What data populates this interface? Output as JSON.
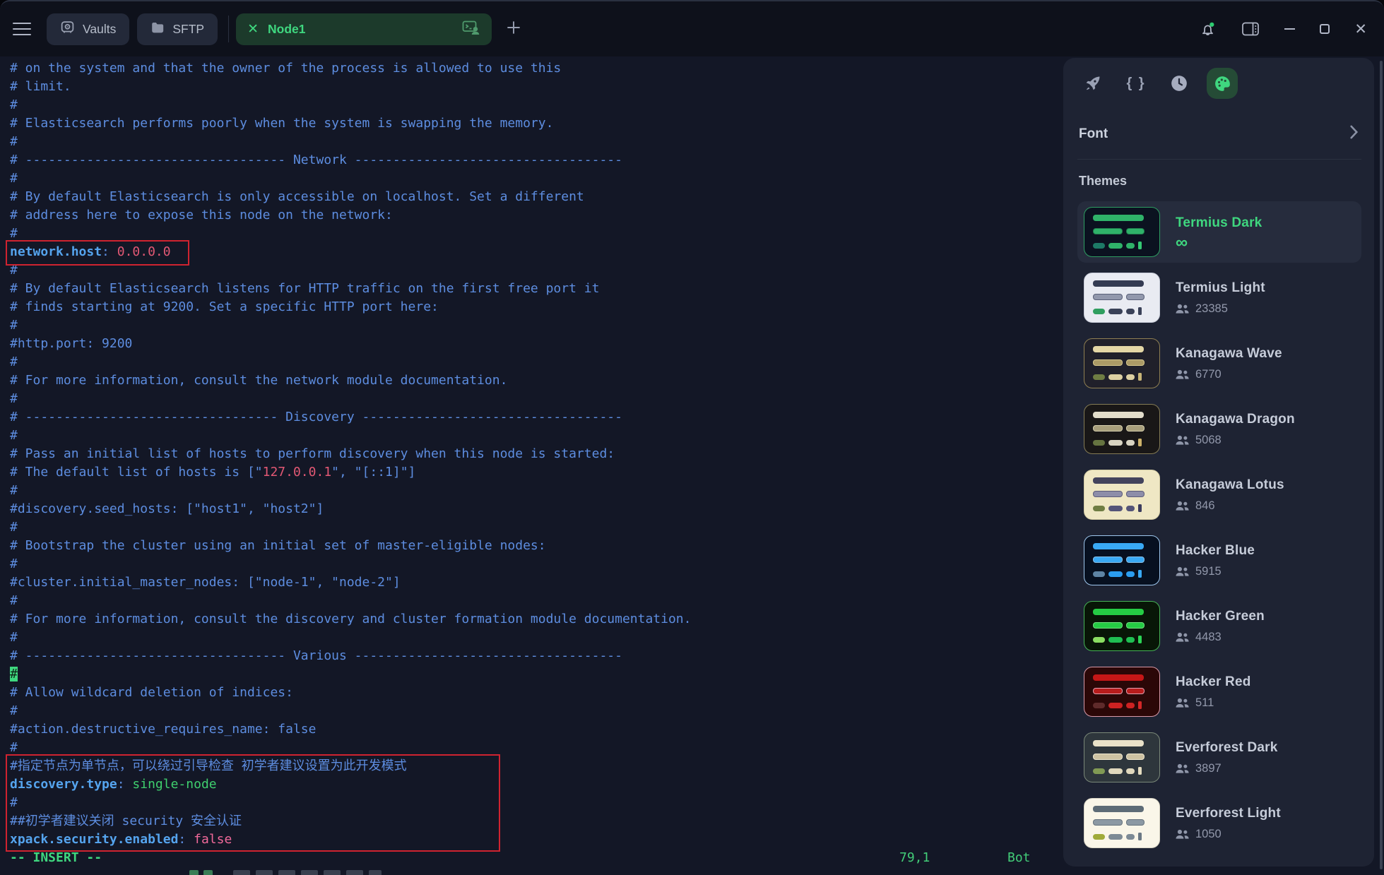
{
  "topbar": {
    "vaults_label": "Vaults",
    "sftp_label": "SFTP",
    "tab_label": "Node1"
  },
  "terminal": {
    "lines": [
      [
        [
          "c",
          "# on the system and that the owner of the process is allowed to use this"
        ]
      ],
      [
        [
          "c",
          "# limit."
        ]
      ],
      [
        [
          "c",
          "#"
        ]
      ],
      [
        [
          "c",
          "# Elasticsearch performs poorly when the system is swapping the memory."
        ]
      ],
      [
        [
          "c",
          "#"
        ]
      ],
      [
        [
          "c",
          "# ---------------------------------- Network -----------------------------------"
        ]
      ],
      [
        [
          "c",
          "#"
        ]
      ],
      [
        [
          "c",
          "# By default Elasticsearch is only accessible on localhost. Set a different"
        ]
      ],
      [
        [
          "c",
          "# address here to expose this node on the network:"
        ]
      ],
      [
        [
          "c",
          "#"
        ]
      ],
      [
        [
          "k",
          "network.host"
        ],
        [
          "c",
          ": "
        ],
        [
          "r",
          "0.0.0.0"
        ]
      ],
      [
        [
          "c",
          "#"
        ]
      ],
      [
        [
          "c",
          "# By default Elasticsearch listens for HTTP traffic on the first free port it"
        ]
      ],
      [
        [
          "c",
          "# finds starting at 9200. Set a specific HTTP port here:"
        ]
      ],
      [
        [
          "c",
          "#"
        ]
      ],
      [
        [
          "c",
          "#http.port: 9200"
        ]
      ],
      [
        [
          "c",
          "#"
        ]
      ],
      [
        [
          "c",
          "# For more information, consult the network module documentation."
        ]
      ],
      [
        [
          "c",
          "#"
        ]
      ],
      [
        [
          "c",
          "# --------------------------------- Discovery ----------------------------------"
        ]
      ],
      [
        [
          "c",
          "#"
        ]
      ],
      [
        [
          "c",
          "# Pass an initial list of hosts to perform discovery when this node is started:"
        ]
      ],
      [
        [
          "c",
          "# The default list of hosts is [\""
        ],
        [
          "r",
          "127.0.0.1"
        ],
        [
          "c",
          "\", \"[::1]\"]"
        ]
      ],
      [
        [
          "c",
          "#"
        ]
      ],
      [
        [
          "c",
          "#discovery.seed_hosts: [\"host1\", \"host2\"]"
        ]
      ],
      [
        [
          "c",
          "#"
        ]
      ],
      [
        [
          "c",
          "# Bootstrap the cluster using an initial set of master-eligible nodes:"
        ]
      ],
      [
        [
          "c",
          "#"
        ]
      ],
      [
        [
          "c",
          "#cluster.initial_master_nodes: [\"node-1\", \"node-2\"]"
        ]
      ],
      [
        [
          "c",
          "#"
        ]
      ],
      [
        [
          "c",
          "# For more information, consult the discovery and cluster formation module documentation."
        ]
      ],
      [
        [
          "c",
          "#"
        ]
      ],
      [
        [
          "c",
          "# ---------------------------------- Various -----------------------------------"
        ]
      ],
      [
        [
          "cur",
          "#"
        ]
      ],
      [
        [
          "c",
          "# Allow wildcard deletion of indices:"
        ]
      ],
      [
        [
          "c",
          "#"
        ]
      ],
      [
        [
          "c",
          "#action.destructive_requires_name: false"
        ]
      ],
      [
        [
          "c",
          "#"
        ]
      ],
      [
        [
          "c",
          "#指定节点为单节点，可以绕过引导检查 初学者建议设置为此开发模式"
        ]
      ],
      [
        [
          "k",
          "discovery.type"
        ],
        [
          "c",
          ": "
        ],
        [
          "g",
          "single-node"
        ]
      ],
      [
        [
          "c",
          "#"
        ]
      ],
      [
        [
          "c",
          "##初学者建议关闭 security 安全认证"
        ]
      ],
      [
        [
          "k",
          "xpack.security.enabled"
        ],
        [
          "c",
          ": "
        ],
        [
          "p",
          "false"
        ]
      ]
    ],
    "status": {
      "mode": "-- INSERT --",
      "position": "79,1",
      "scroll": "Bot"
    }
  },
  "sidebar": {
    "font_label": "Font",
    "themes_label": "Themes",
    "themes": [
      {
        "name": "Termius Dark",
        "users": "∞",
        "selected": true,
        "colors": {
          "bg": "#0b1220",
          "bd": "#2e9e62",
          "c1": "#2fb269",
          "c2": "#2fb269",
          "c2o": "#1f7a4c",
          "c3a": "#1d7a66",
          "c3b": "#2fb269",
          "cur": "#35c974"
        }
      },
      {
        "name": "Termius Light",
        "users": "23385",
        "selected": false,
        "colors": {
          "bg": "#e9ebf2",
          "bd": "#c8ccd8",
          "c1": "#343b52",
          "c2": "#9298ac",
          "c2o": "#5a6078",
          "c3a": "#2f9e5f",
          "c3b": "#3a4158",
          "cur": "#3a4158"
        }
      },
      {
        "name": "Kanagawa Wave",
        "users": "6770",
        "selected": false,
        "colors": {
          "bg": "#20202a",
          "bd": "#8f7f52",
          "c1": "#e4d7a6",
          "c2": "#ab9a66",
          "c2o": "#d8c98e",
          "c3a": "#6f7d43",
          "c3b": "#ddd0a2",
          "cur": "#c9b678"
        }
      },
      {
        "name": "Kanagawa Dragon",
        "users": "5068",
        "selected": false,
        "colors": {
          "bg": "#191717",
          "bd": "#857c55",
          "c1": "#e2ddcb",
          "c2": "#a79e7b",
          "c2o": "#d6cfae",
          "c3a": "#667440",
          "c3b": "#d9d4c2",
          "cur": "#cdb26a"
        }
      },
      {
        "name": "Kanagawa Lotus",
        "users": "846",
        "selected": false,
        "colors": {
          "bg": "#efe7c4",
          "bd": "#d5cda5",
          "c1": "#43435c",
          "c2": "#8d8da9",
          "c2o": "#5c5c7a",
          "c3a": "#6f7d43",
          "c3b": "#545478",
          "cur": "#3c3c5e"
        }
      },
      {
        "name": "Hacker Blue",
        "users": "5915",
        "selected": false,
        "colors": {
          "bg": "#071020",
          "bd": "#9ec7ee",
          "c1": "#39a9f4",
          "c2": "#39a9f4",
          "c2o": "#86bfe8",
          "c3a": "#5e84a4",
          "c3b": "#2b9df0",
          "cur": "#39a9f4"
        }
      },
      {
        "name": "Hacker Green",
        "users": "4483",
        "selected": false,
        "colors": {
          "bg": "#081607",
          "bd": "#46b355",
          "c1": "#25cc44",
          "c2": "#25cc44",
          "c2o": "#6fe07f",
          "c3a": "#8ade62",
          "c3b": "#1fbf52",
          "cur": "#2bd455"
        }
      },
      {
        "name": "Hacker Red",
        "users": "511",
        "selected": false,
        "colors": {
          "bg": "#2b0707",
          "bd": "#d89aa8",
          "c1": "#c51717",
          "c2": "#b81c1c",
          "c2o": "#e0a0b0",
          "c3a": "#5f2a2a",
          "c3b": "#cd2222",
          "cur": "#d32727"
        }
      },
      {
        "name": "Everforest Dark",
        "users": "3897",
        "selected": false,
        "colors": {
          "bg": "#2e363c",
          "bd": "#7a8878",
          "c1": "#e9e1c8",
          "c2": "#cdc2a2",
          "c2o": "#efe8d0",
          "c3a": "#819a54",
          "c3b": "#e0d8bd",
          "cur": "#e4dcc0"
        }
      },
      {
        "name": "Everforest Light",
        "users": "1050",
        "selected": false,
        "colors": {
          "bg": "#faf6e9",
          "bd": "#d8d4c4",
          "c1": "#5d6b76",
          "c2": "#8c99a4",
          "c2o": "#66737e",
          "c3a": "#a0ab3a",
          "c3b": "#7d8a95",
          "cur": "#6b7884"
        }
      }
    ]
  },
  "colors": {
    "accent_green": "#3fd77f",
    "annotation_red": "#cf2330",
    "panel_bg": "#1e2333",
    "terminal_bg": "#131726"
  }
}
